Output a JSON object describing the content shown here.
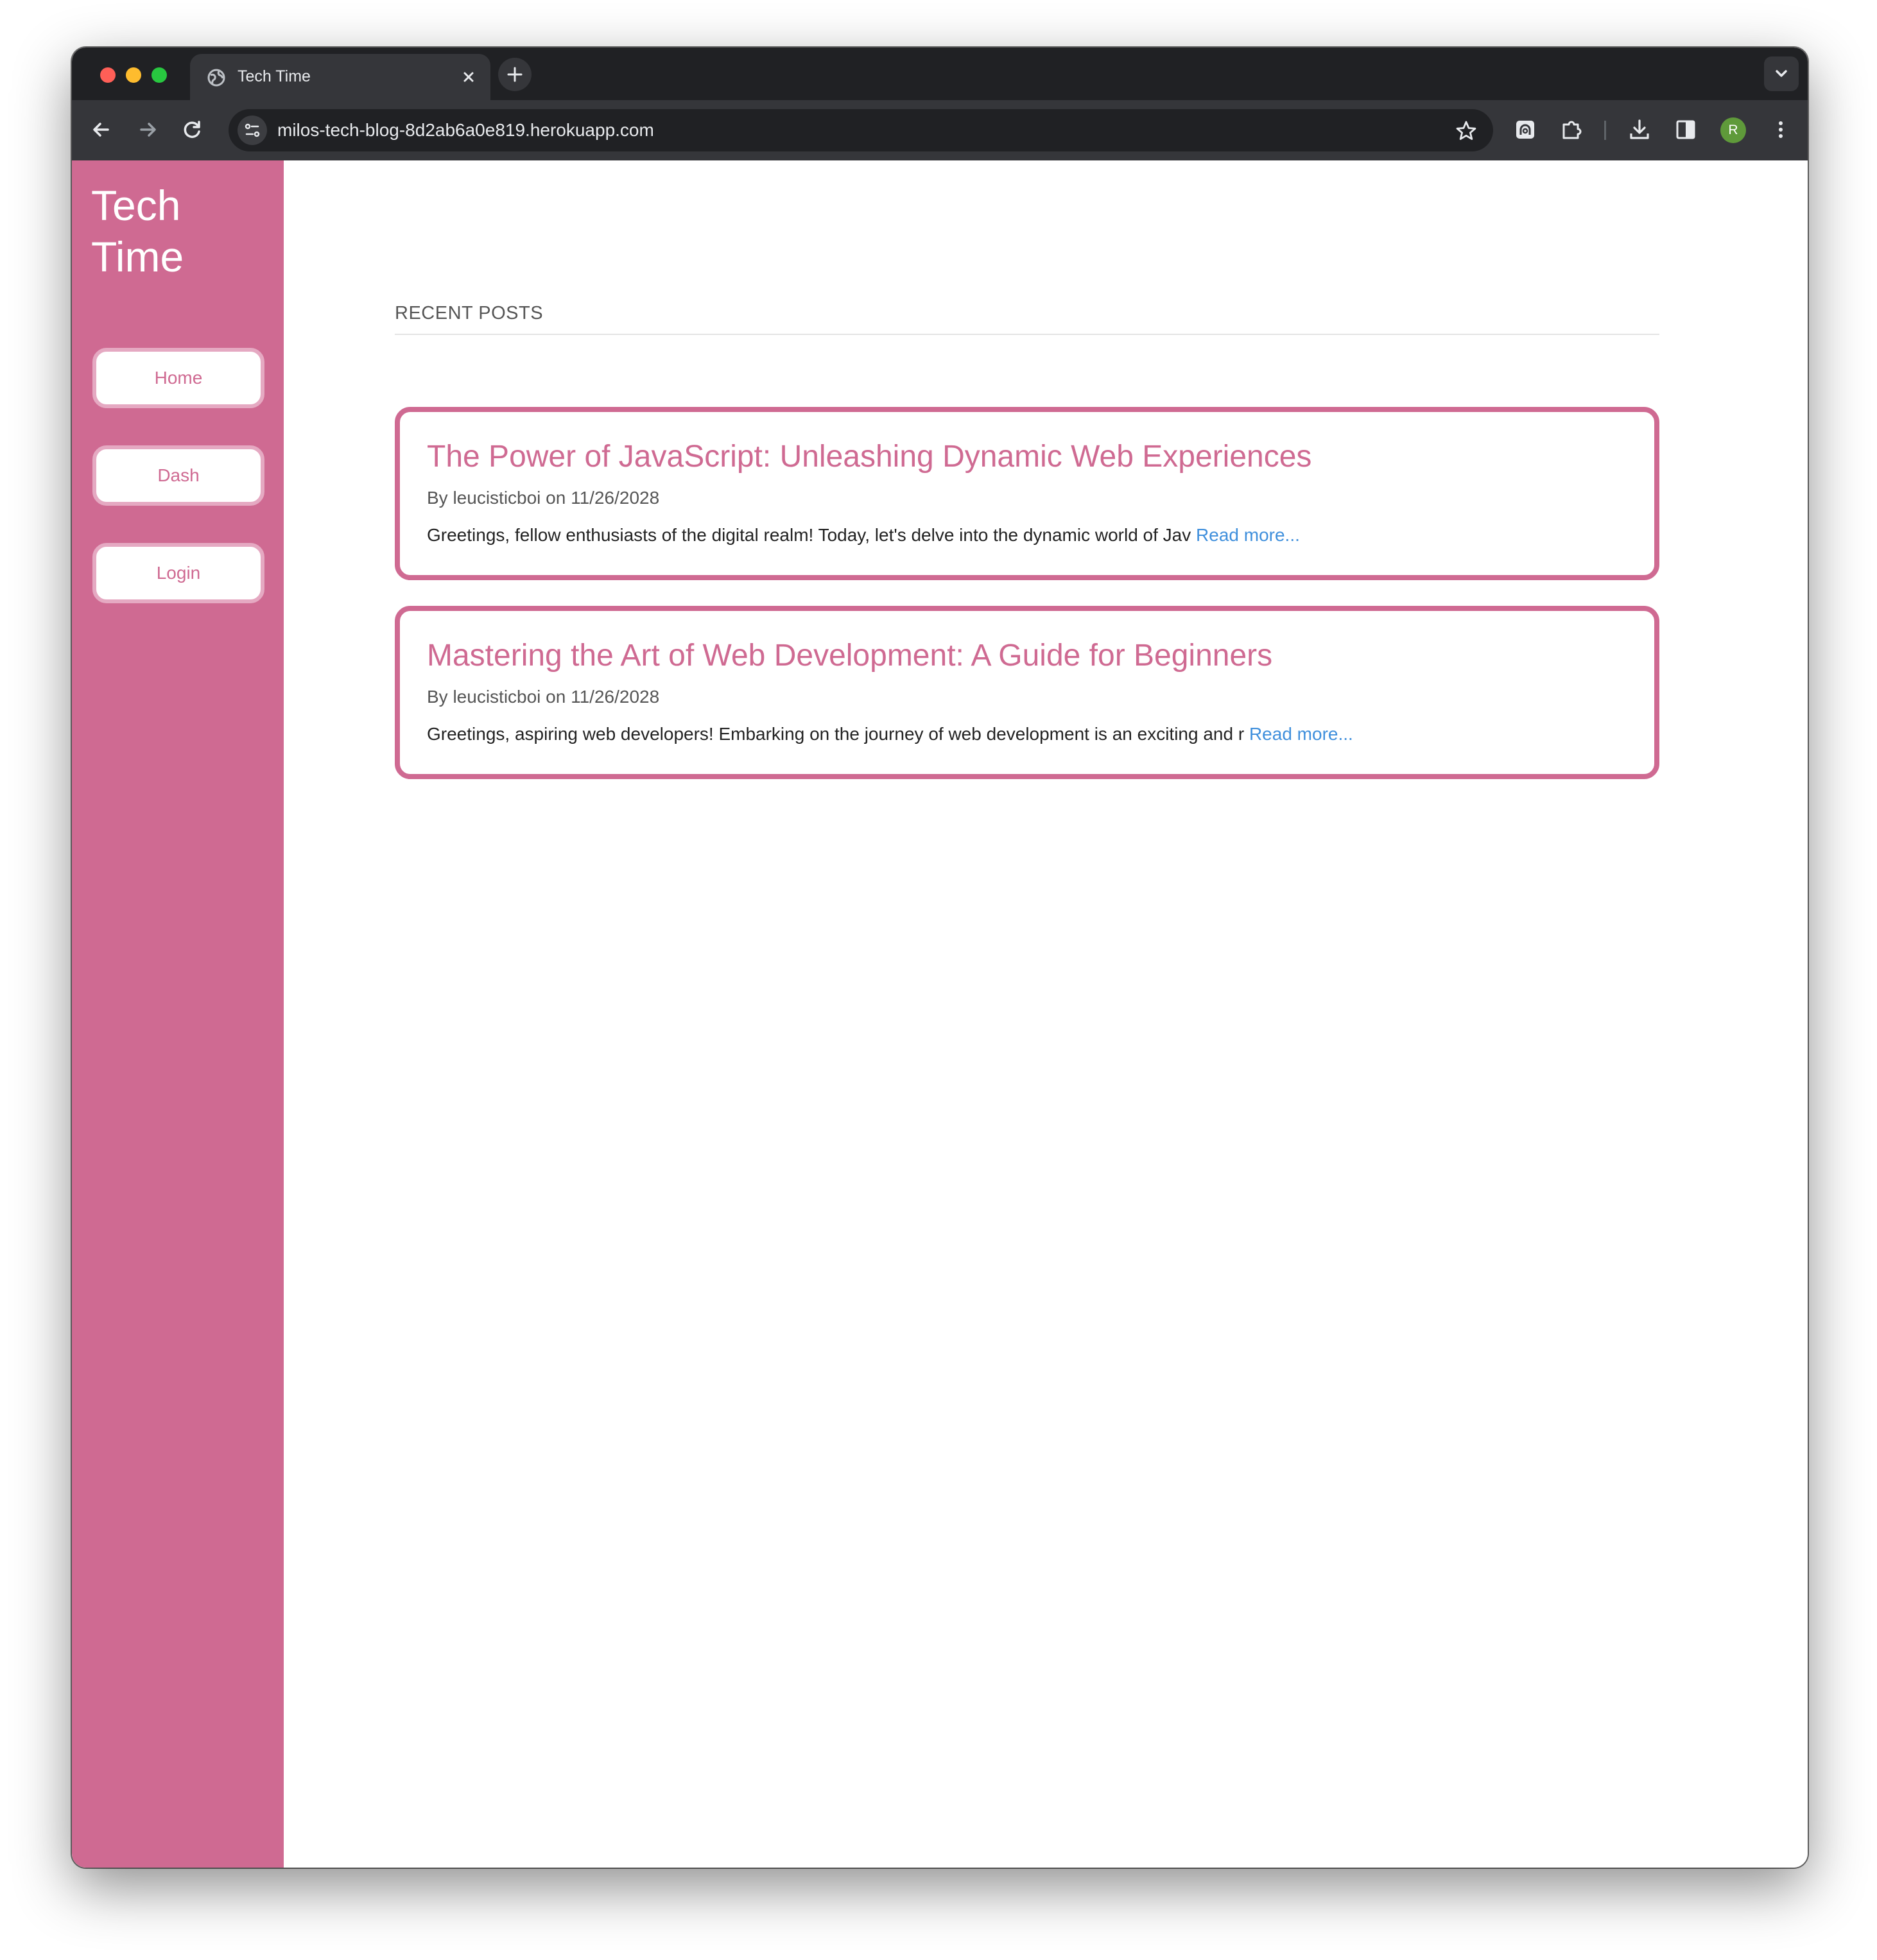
{
  "browser": {
    "tab_title": "Tech Time",
    "url": "milos-tech-blog-8d2ab6a0e819.herokuapp.com",
    "profile_initial": "R",
    "icons": {
      "tab_favicon": "globe-icon",
      "tab_close": "close-icon",
      "new_tab": "plus-icon",
      "tab_list": "chevron-down-icon",
      "back": "arrow-left-icon",
      "forward": "arrow-right-icon",
      "reload": "reload-icon",
      "site_info": "tune-icon",
      "bookmark": "star-icon",
      "extension_1": "password-manager-icon",
      "extensions": "puzzle-icon",
      "downloads": "download-icon",
      "side_panel": "side-panel-icon",
      "menu": "kebab-menu-icon"
    }
  },
  "sidebar": {
    "brand": "Tech Time",
    "nav": [
      {
        "label": "Home"
      },
      {
        "label": "Dash"
      },
      {
        "label": "Login"
      }
    ]
  },
  "main": {
    "section_title": "RECENT POSTS",
    "posts": [
      {
        "title": "The Power of JavaScript: Unleashing Dynamic Web Experiences",
        "meta": "By leucisticboi on 11/26/2028",
        "excerpt": "Greetings, fellow enthusiasts of the digital realm! Today, let's delve into the dynamic world of Jav",
        "read_more": "Read more..."
      },
      {
        "title": "Mastering the Art of Web Development: A Guide for Beginners",
        "meta": "By leucisticboi on 11/26/2028",
        "excerpt": "Greetings, aspiring web developers! Embarking on the journey of web development is an exciting and r",
        "read_more": "Read more..."
      }
    ]
  },
  "colors": {
    "accent": "#cf6a92",
    "link": "#3f8fdc",
    "chrome_dark": "#202124",
    "chrome_toolbar": "#35363a"
  }
}
